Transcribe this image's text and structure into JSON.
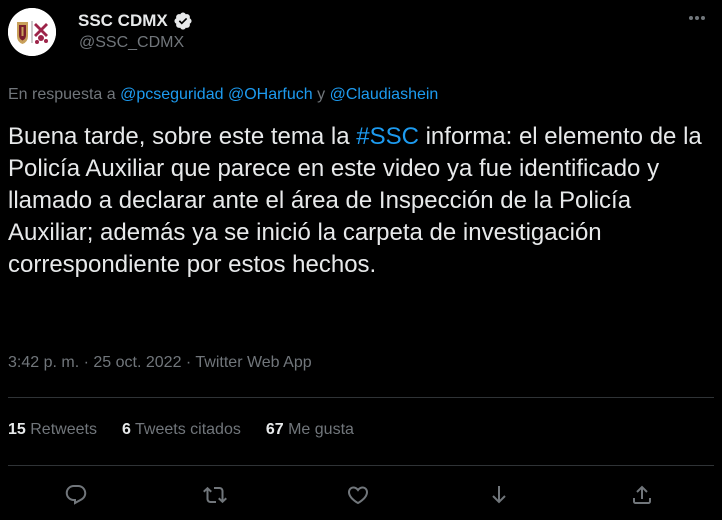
{
  "author": {
    "display_name": "SSC CDMX",
    "handle": "@SSC_CDMX",
    "verified": true
  },
  "reply": {
    "prefix": "En respuesta a",
    "mentions": [
      "@pcseguridad",
      "@OHarfuch",
      "@Claudiashein"
    ],
    "conjunction": "y"
  },
  "tweet": {
    "part1": "Buena tarde, sobre este tema la ",
    "hashtag": "#SSC",
    "part2": " informa: el elemento de la Policía Auxiliar que parece en este video ya fue identificado y llamado a declarar ante el área de Inspección de la Policía Auxiliar; además ya se inició la carpeta de investigación correspondiente por estos hechos."
  },
  "meta": {
    "time": "3:42 p. m.",
    "separator": "·",
    "date": "25 oct. 2022",
    "source": "Twitter Web App"
  },
  "stats": {
    "retweets_count": "15",
    "retweets_label": "Retweets",
    "quotes_count": "6",
    "quotes_label": "Tweets citados",
    "likes_count": "67",
    "likes_label": "Me gusta"
  },
  "icons": {
    "more": "more-icon",
    "reply": "reply-icon",
    "retweet": "retweet-icon",
    "like": "heart-icon",
    "bookmark": "download-icon",
    "share": "share-icon",
    "verified": "verified-badge-icon"
  },
  "colors": {
    "background": "#000000",
    "text": "#e7e9ea",
    "secondary": "#71767b",
    "accent": "#1d9bf0",
    "divider": "#2f3336"
  }
}
